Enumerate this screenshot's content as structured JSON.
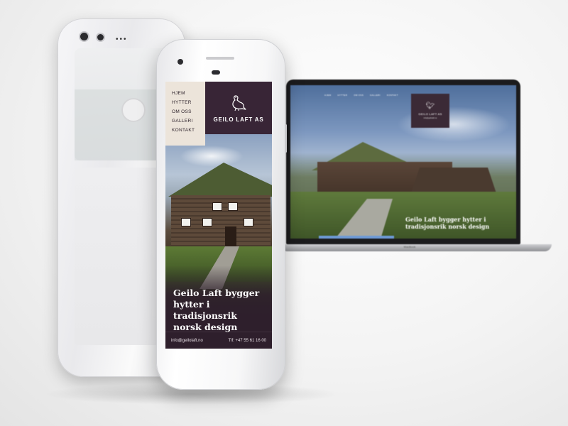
{
  "laptop": {
    "nav_items": [
      "HJEM",
      "HYTTER",
      "OM OSS",
      "GALLERI",
      "KONTAKT"
    ],
    "brand_title": "GEILO LAFT AS",
    "brand_sub": "info@geilolaft.no",
    "headline": "Geilo Laft bygger hytter i tradisjonsrik norsk design",
    "model": "MacBook"
  },
  "phone": {
    "nav": {
      "items": [
        {
          "label": "HJEM"
        },
        {
          "label": "HYTTER"
        },
        {
          "label": "OM OSS"
        },
        {
          "label": "GALLERI"
        },
        {
          "label": "KONTAKT"
        }
      ]
    },
    "brand_title": "GEILO LAFT AS",
    "headline": "Geilo Laft bygger hytter i tradisjonsrik norsk design",
    "footer": {
      "email": "info@geilolaft.no",
      "phone": "Tlf: +47 55 61 16 00"
    }
  },
  "colors": {
    "brand_purple": "#382536",
    "nav_beige": "#ece4da",
    "hero_dark": "#2e1f2c"
  },
  "icons": {
    "logo": "grouse-bird-icon"
  }
}
